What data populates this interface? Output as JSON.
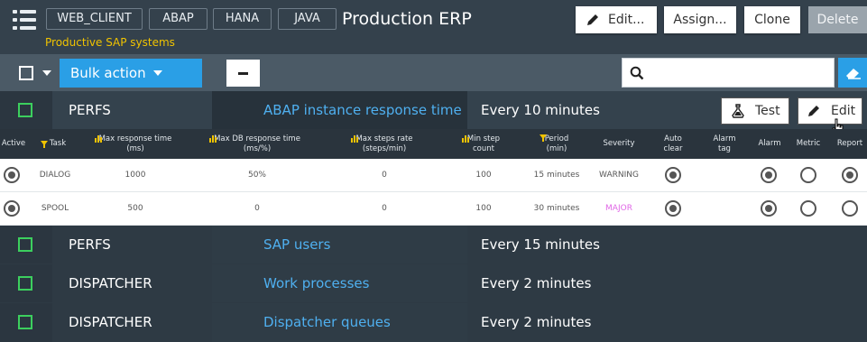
{
  "header": {
    "tags": [
      "WEB_CLIENT",
      "ABAP",
      "HANA",
      "JAVA"
    ],
    "title": "Production ERP",
    "subtitle": "Productive SAP systems",
    "buttons": {
      "edit": "Edit...",
      "assign": "Assign...",
      "clone": "Clone",
      "delete": "Delete"
    }
  },
  "toolbar": {
    "bulk_action": "Bulk action",
    "search_value": ""
  },
  "monitors": [
    {
      "type": "PERFS",
      "name": "ABAP instance response time",
      "schedule": "Every 10 minutes",
      "expanded": true
    },
    {
      "type": "PERFS",
      "name": "SAP users",
      "schedule": "Every 15 minutes"
    },
    {
      "type": "DISPATCHER",
      "name": "Work processes",
      "schedule": "Every 2 minutes"
    },
    {
      "type": "DISPATCHER",
      "name": "Dispatcher queues",
      "schedule": "Every 2 minutes"
    }
  ],
  "row_actions": {
    "test": "Test",
    "edit": "Edit"
  },
  "table": {
    "headers": {
      "active": "Active",
      "task": "Task",
      "max_resp_1": "Max response time",
      "max_resp_2": "(ms)",
      "max_db_1": "Max DB response time",
      "max_db_2": "(ms/%)",
      "max_steps_1": "Max steps rate",
      "max_steps_2": "(steps/min)",
      "min_step_1": "Min step",
      "min_step_2": "count",
      "period_1": "Period",
      "period_2": "(min)",
      "severity": "Severity",
      "auto_clear_1": "Auto",
      "auto_clear_2": "clear",
      "alarm_tag_1": "Alarm",
      "alarm_tag_2": "tag",
      "alarm": "Alarm",
      "metric": "Metric",
      "report": "Report"
    },
    "rows": [
      {
        "task": "DIALOG",
        "max_resp": "1000",
        "max_db": "50%",
        "max_steps": "0",
        "min_step": "100",
        "period": "15 minutes",
        "severity": "WARNING",
        "severity_color": "#555555",
        "active": true,
        "auto_clear": true,
        "alarm": true,
        "metric": false,
        "report": true
      },
      {
        "task": "SPOOL",
        "max_resp": "500",
        "max_db": "0",
        "max_steps": "0",
        "min_step": "100",
        "period": "30 minutes",
        "severity": "MAJOR",
        "severity_color": "#e066e6",
        "active": true,
        "auto_clear": true,
        "alarm": true,
        "metric": false,
        "report": false
      }
    ]
  },
  "colors": {
    "accent": "#2a9fe6",
    "link": "#4fb0f0",
    "checkbox_green": "#3ccf5e",
    "subtitle_yellow": "#f0c300"
  }
}
